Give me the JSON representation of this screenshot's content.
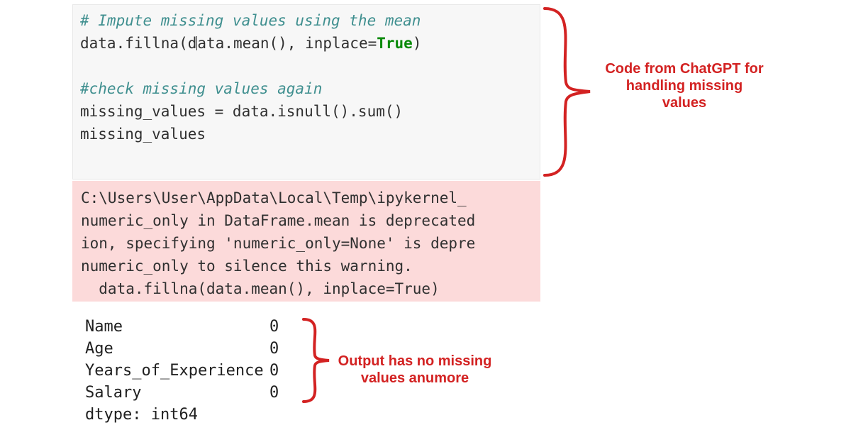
{
  "code": {
    "line1_comment": "# Impute missing values using the mean",
    "line2_a": "data.fillna(d",
    "line2_b": "ata.mean(), inplace=",
    "line2_true": "True",
    "line2_end": ")",
    "blank": "",
    "line4_comment": "#check missing values again",
    "line5": "missing_values = data.isnull().sum()",
    "line6": "missing_values"
  },
  "warning": {
    "l1": "C:\\Users\\User\\AppData\\Local\\Temp\\ipykernel_",
    "l2": "numeric_only in DataFrame.mean is deprecated",
    "l3": "ion, specifying 'numeric_only=None' is depre",
    "l4": "numeric_only to silence this warning.",
    "l5": "  data.fillna(data.mean(), inplace=True)"
  },
  "output": {
    "rows": [
      {
        "key": "Name",
        "val": "0"
      },
      {
        "key": "Age",
        "val": "0"
      },
      {
        "key": "Years_of_Experience",
        "val": "0"
      },
      {
        "key": "Salary",
        "val": "0"
      }
    ],
    "dtype": "dtype: int64"
  },
  "annotations": {
    "top": "Code from ChatGPT for handling missing values",
    "bottom": "Output has no missing values anumore"
  }
}
